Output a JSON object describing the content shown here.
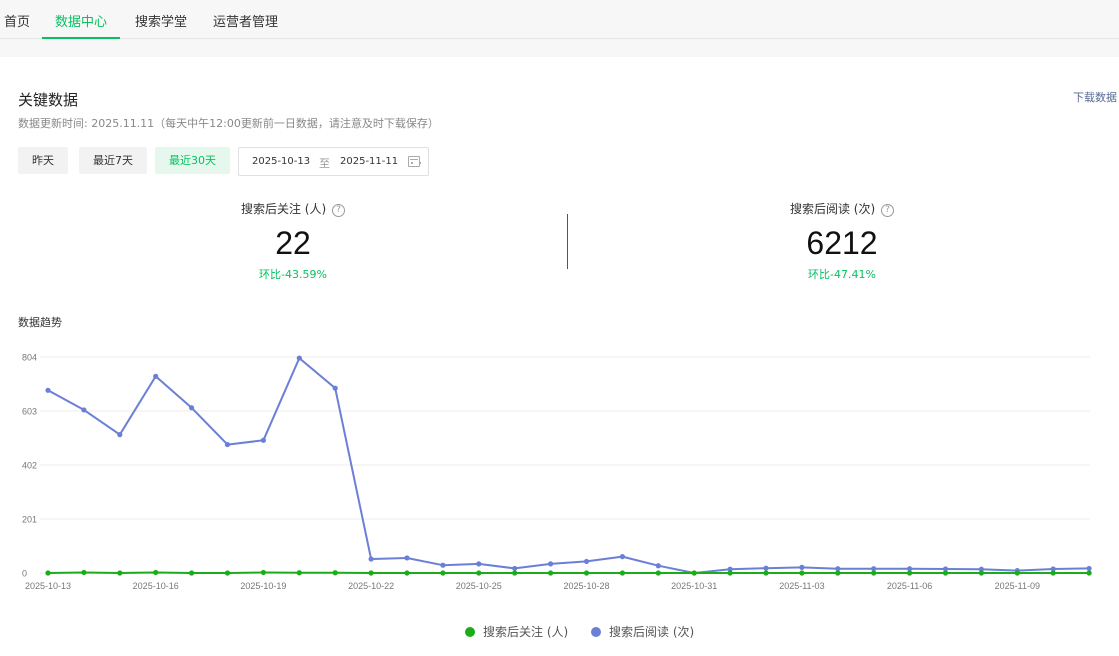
{
  "nav": {
    "tabs": [
      {
        "label": "首页"
      },
      {
        "label": "数据中心"
      },
      {
        "label": "搜索学堂"
      },
      {
        "label": "运营者管理"
      }
    ]
  },
  "header": {
    "title": "关键数据",
    "update_note": "数据更新时间: 2025.11.11（每天中午12:00更新前一日数据，请注意及时下载保存）",
    "download_label": "下载数据"
  },
  "filters": {
    "ranges": [
      {
        "label": "昨天",
        "active": false
      },
      {
        "label": "最近7天",
        "active": false
      },
      {
        "label": "最近30天",
        "active": true
      }
    ],
    "start_date": "2025-10-13",
    "separator": "至",
    "end_date": "2025-11-11"
  },
  "stats": [
    {
      "label": "搜索后关注 (人)",
      "value": "22",
      "change": "环比-43.59%"
    },
    {
      "label": "搜索后阅读 (次)",
      "value": "6212",
      "change": "环比-47.41%"
    }
  ],
  "help_glyph": "?",
  "trend": {
    "title": "数据趋势"
  },
  "colors": {
    "accent": "#07c160",
    "follow_series": "#1aad19",
    "read_series": "#6b7fd7",
    "link": "#576b95"
  },
  "chart_data": {
    "type": "line",
    "x": [
      "2025-10-13",
      "2025-10-14",
      "2025-10-15",
      "2025-10-16",
      "2025-10-17",
      "2025-10-18",
      "2025-10-19",
      "2025-10-20",
      "2025-10-21",
      "2025-10-22",
      "2025-10-23",
      "2025-10-24",
      "2025-10-25",
      "2025-10-26",
      "2025-10-27",
      "2025-10-28",
      "2025-10-29",
      "2025-10-30",
      "2025-10-31",
      "2025-11-01",
      "2025-11-02",
      "2025-11-03",
      "2025-11-04",
      "2025-11-05",
      "2025-11-06",
      "2025-11-07",
      "2025-11-08",
      "2025-11-09",
      "2025-11-10",
      "2025-11-11"
    ],
    "x_tick_labels": [
      "2025-10-13",
      "2025-10-16",
      "2025-10-19",
      "2025-10-22",
      "2025-10-25",
      "2025-10-28",
      "2025-10-31",
      "2025-11-03",
      "2025-11-06",
      "2025-11-09"
    ],
    "y_ticks": [
      0,
      201,
      402,
      603,
      804
    ],
    "ylim": [
      0,
      804
    ],
    "grid": true,
    "legend_position": "bottom",
    "series": [
      {
        "name": "搜索后关注 (人)",
        "values": [
          0,
          2,
          0,
          2,
          0,
          0,
          2,
          1,
          1,
          0,
          0,
          0,
          0,
          0,
          0,
          0,
          0,
          0,
          0,
          0,
          0,
          0,
          0,
          0,
          0,
          0,
          0,
          0,
          0,
          0
        ]
      },
      {
        "name": "搜索后阅读 (次)",
        "values": [
          680,
          607,
          515,
          732,
          615,
          478,
          494,
          800,
          688,
          52,
          56,
          29,
          34,
          17,
          34,
          43,
          61,
          27,
          0,
          14,
          18,
          21,
          16,
          16,
          16,
          15,
          14,
          9,
          15,
          17
        ]
      }
    ]
  }
}
